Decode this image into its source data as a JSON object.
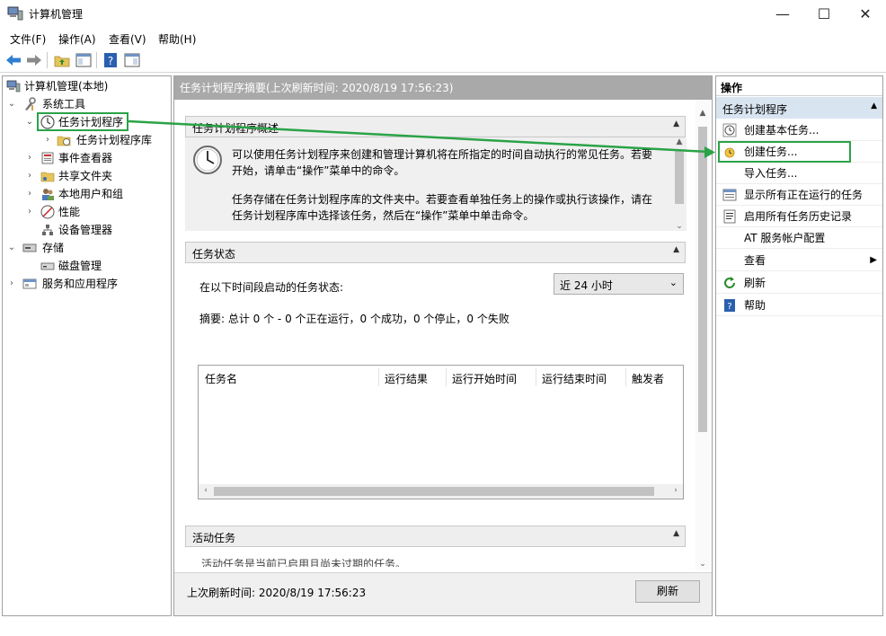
{
  "window": {
    "title": "计算机管理",
    "minimize": "—",
    "maximize": "☐",
    "close": "✕"
  },
  "menu": {
    "file": "文件(F)",
    "action": "操作(A)",
    "view": "查看(V)",
    "help": "帮助(H)"
  },
  "tree": {
    "root": "计算机管理(本地)",
    "system_tools": "系统工具",
    "task_scheduler": "任务计划程序",
    "task_scheduler_library": "任务计划程序库",
    "event_viewer": "事件查看器",
    "shared_folders": "共享文件夹",
    "local_users": "本地用户和组",
    "performance": "性能",
    "device_manager": "设备管理器",
    "storage": "存储",
    "disk_management": "磁盘管理",
    "services_apps": "服务和应用程序"
  },
  "center": {
    "header": "任务计划程序摘要(上次刷新时间: 2020/8/19 17:56:23)",
    "overview_title": "任务计划程序概述",
    "overview_p1_line1": "可以使用任务计划程序来创建和管理计算机将在所指定的时间自动执行的常见任务。若要",
    "overview_p1_line2": "开始，请单击“操作”菜单中的命令。",
    "overview_p2_line1": "任务存储在任务计划程序库的文件夹中。若要查看单独任务上的操作或执行该操作，请在",
    "overview_p2_line2": "任务计划程序库中选择该任务，然后在“操作”菜单中单击命令。",
    "status_title": "任务状态",
    "status_label": "在以下时间段启动的任务状态:",
    "period_selected": "近 24 小时",
    "summary": "摘要: 总计 0 个 - 0 个正在运行，0 个成功，0 个停止，0 个失败",
    "columns": [
      "任务名",
      "运行结果",
      "运行开始时间",
      "运行结束时间",
      "触发者"
    ],
    "active_title": "活动任务",
    "active_partial": "活动任务是当前已启用且尚未过期的任务。",
    "footer_time": "上次刷新时间: 2020/8/19 17:56:23",
    "refresh_button": "刷新"
  },
  "actions": {
    "title": "操作",
    "group": "任务计划程序",
    "items": [
      {
        "label": "创建基本任务...",
        "icon": "clock-wizard-icon"
      },
      {
        "label": "创建任务...",
        "icon": "task-icon"
      },
      {
        "label": "导入任务...",
        "icon": ""
      },
      {
        "label": "显示所有正在运行的任务",
        "icon": "running-tasks-icon"
      },
      {
        "label": "启用所有任务历史记录",
        "icon": "history-icon"
      },
      {
        "label": "AT 服务帐户配置",
        "icon": ""
      },
      {
        "label": "查看",
        "icon": ""
      },
      {
        "label": "刷新",
        "icon": "refresh-icon"
      },
      {
        "label": "帮助",
        "icon": "help-icon"
      }
    ]
  },
  "colors": {
    "highlight": "#2aa347",
    "actions_group_bg": "#d9e4f1",
    "header_bg": "#a9a9a9"
  }
}
